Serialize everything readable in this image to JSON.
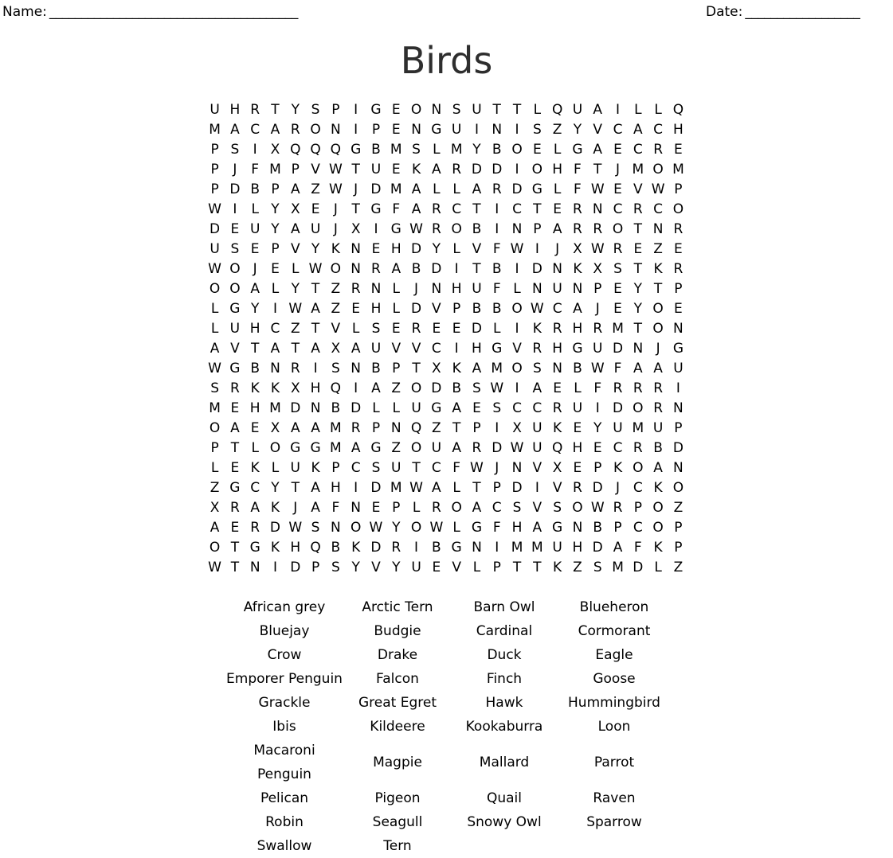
{
  "header": {
    "name_label": "Name:",
    "name_rule": "_______________________________________",
    "date_label": "Date:",
    "date_rule": "__________________"
  },
  "title": "Birds",
  "grid": {
    "columns": 24,
    "rows": [
      "U H R T Y S P I G E O N S U T T L Q U A I L L Q",
      "M A C A R O N I P E N G U I N I S Z Y V C A C H",
      "P S I X Q Q Q G B M S L M Y B O E L G A E C R E",
      "P J F M P V W T U E K A R D D I O H F T J M O M",
      "P D B P A Z W J D M A L L A R D G L F W E V W P",
      "W I L Y X E J T G F A R C T I C T E R N C R C O",
      "D E U Y A U J X I G W R O B I N P A R R O T N R",
      "U S E P V Y K N E H D Y L V F W I J X W R E Z E",
      "W O J E L W O N R A B D I T B I D N K X S T K R",
      "O O A L Y T Z R N L J N H U F L N U N P E Y T P",
      "L G Y I W A Z E H L D V P B B O W C A J E Y O E",
      "L U H C Z T V L S E R E E D L I K R H R M T O N",
      "A V T A T A X A U V V C I H G V R H G U D N J G",
      "W G B N R I S N B P T X K A M O S N B W F A A U",
      "S R K K X H Q I A Z O D B S W I A E L F R R R I",
      "M E H M D N B D L L U G A E S C C R U I D O R N",
      "O A E X A A M R P N Q Z T P I X U K E Y U M U P",
      "P T L O G G M A G Z O U A R D W U Q H E C R B D",
      "L E K L U K P C S U T C F W J N V X E P K O A N",
      "Z G C Y T A H I D M W A L T P D I V R D J C K O",
      "X R A K J A F N E P L R O A C S V S O W R P O Z",
      "A E R D W S N O W Y O W L G F H A G N B P C O P",
      "O T G K H Q B K D R I B G N I M M U H D A F K P",
      "W T N I D P S Y V Y U E V L P T T K Z S M D L Z"
    ]
  },
  "wordlist": {
    "columns": 4,
    "words": [
      "African grey",
      "Arctic Tern",
      "Barn Owl",
      "Blueheron",
      "Bluejay",
      "Budgie",
      "Cardinal",
      "Cormorant",
      "Crow",
      "Drake",
      "Duck",
      "Eagle",
      "Emporer Penguin",
      "Falcon",
      "Finch",
      "Goose",
      "Grackle",
      "Great Egret",
      "Hawk",
      "Hummingbird",
      "Ibis",
      "Kildeere",
      "Kookaburra",
      "Loon",
      "Macaroni Penguin",
      "Magpie",
      "Mallard",
      "Parrot",
      "Pelican",
      "Pigeon",
      "Quail",
      "Raven",
      "Robin",
      "Seagull",
      "Snowy Owl",
      "Sparrow",
      "Swallow",
      "Tern",
      "",
      ""
    ]
  }
}
